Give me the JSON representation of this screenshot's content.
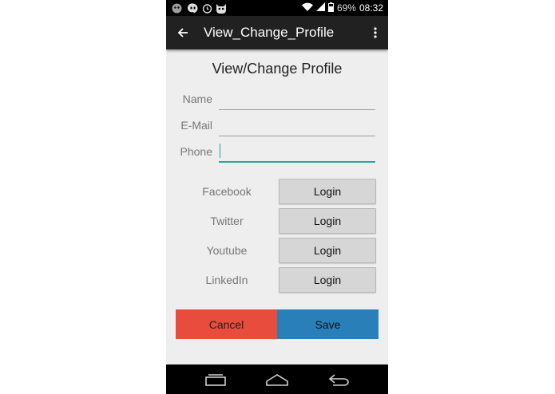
{
  "status_bar": {
    "time": "08:32",
    "battery": "69%",
    "icons": [
      "ghost-icon",
      "hangouts-icon",
      "alarm-icon",
      "cat-icon",
      "wifi-icon",
      "signal-icon",
      "battery-icon"
    ]
  },
  "action_bar": {
    "title": "View_Change_Profile",
    "icons": [
      "back-arrow-icon",
      "overflow-menu-icon"
    ]
  },
  "form": {
    "heading": "View/Change Profile",
    "fields": [
      {
        "label": "Name",
        "value": ""
      },
      {
        "label": "E-Mail",
        "value": ""
      },
      {
        "label": "Phone",
        "value": ""
      }
    ]
  },
  "social": [
    {
      "label": "Facebook",
      "button": "Login"
    },
    {
      "label": "Twitter",
      "button": "Login"
    },
    {
      "label": "Youtube",
      "button": "Login"
    },
    {
      "label": "LinkedIn",
      "button": "Login"
    }
  ],
  "actions": {
    "cancel": "Cancel",
    "save": "Save"
  },
  "nav_bar": {
    "icons": [
      "recents-icon",
      "home-icon",
      "back-icon"
    ]
  },
  "colors": {
    "action_bar": "#212121",
    "accent": "#26a69a",
    "cancel": "#e74c3c",
    "save": "#2980b9",
    "background": "#eeeeee"
  }
}
